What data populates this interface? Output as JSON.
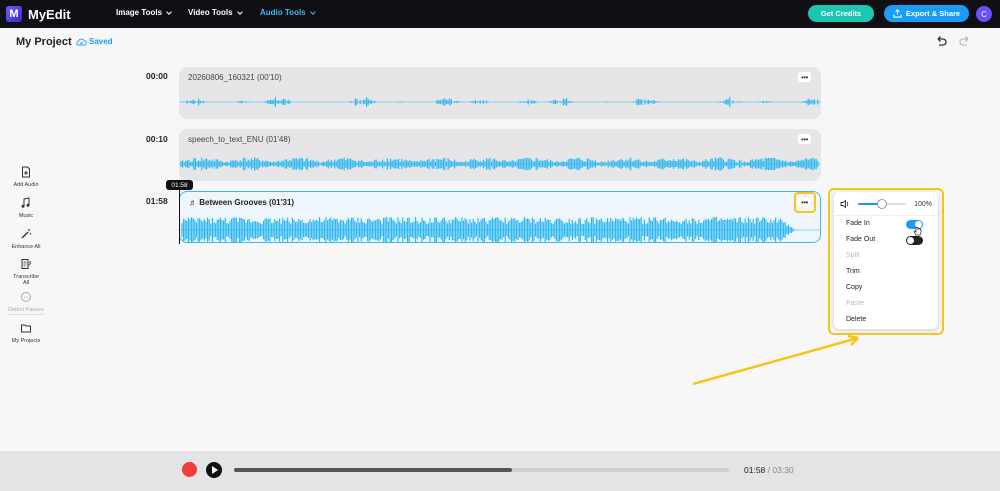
{
  "app": {
    "name": "MyEdit",
    "logo_letter": "M"
  },
  "nav": [
    {
      "label": "Image Tools",
      "active": false
    },
    {
      "label": "Video Tools",
      "active": false
    },
    {
      "label": "Audio Tools",
      "active": true
    }
  ],
  "header_buttons": {
    "credits": "Get Credits",
    "export": "Export & Share",
    "avatar": "C"
  },
  "project": {
    "title": "My Project",
    "status": "Saved"
  },
  "sidebar": [
    {
      "label": "Add Audio",
      "icon": "add-audio-icon",
      "enabled": true
    },
    {
      "label": "Music",
      "icon": "music-icon",
      "enabled": true
    },
    {
      "label": "Enhance All",
      "icon": "magic-wand-icon",
      "enabled": true
    },
    {
      "label": "Transcribe",
      "label2": "All",
      "icon": "transcribe-icon",
      "enabled": true
    },
    {
      "label": "Detect Pauses",
      "icon": "pause-detect-icon",
      "enabled": false
    },
    {
      "label": "My Projects",
      "icon": "folder-icon",
      "enabled": true
    }
  ],
  "tracks": [
    {
      "start": "00:00",
      "name": "20260806_160321  (00'10)",
      "selected": false
    },
    {
      "start": "00:10",
      "name": "speech_to_text_ENU  (01'48)",
      "selected": false
    },
    {
      "start": "01:58",
      "name": "♬ Between Grooves  (01'31)",
      "selected": true
    }
  ],
  "more_label": "•••",
  "playhead": "01:58",
  "menu": {
    "volume_percent": "100%",
    "volume_level": 0.5,
    "items": [
      {
        "label": "Fade In",
        "enabled": true,
        "toggle": "on"
      },
      {
        "label": "Fade Out",
        "enabled": true,
        "toggle": "off"
      },
      {
        "label": "Split",
        "enabled": false
      },
      {
        "label": "Trim",
        "enabled": true
      },
      {
        "label": "Copy",
        "enabled": true
      },
      {
        "label": "Paste",
        "enabled": false
      },
      {
        "label": "Delete",
        "enabled": true
      }
    ]
  },
  "player": {
    "current": "01:58",
    "separator": " / ",
    "total": "03:30",
    "progress": 0.5619
  },
  "colors": {
    "accent": "#1a9cf5",
    "wave": "#2db8f0",
    "highlight": "#f5c518",
    "record": "#f23c3c"
  }
}
